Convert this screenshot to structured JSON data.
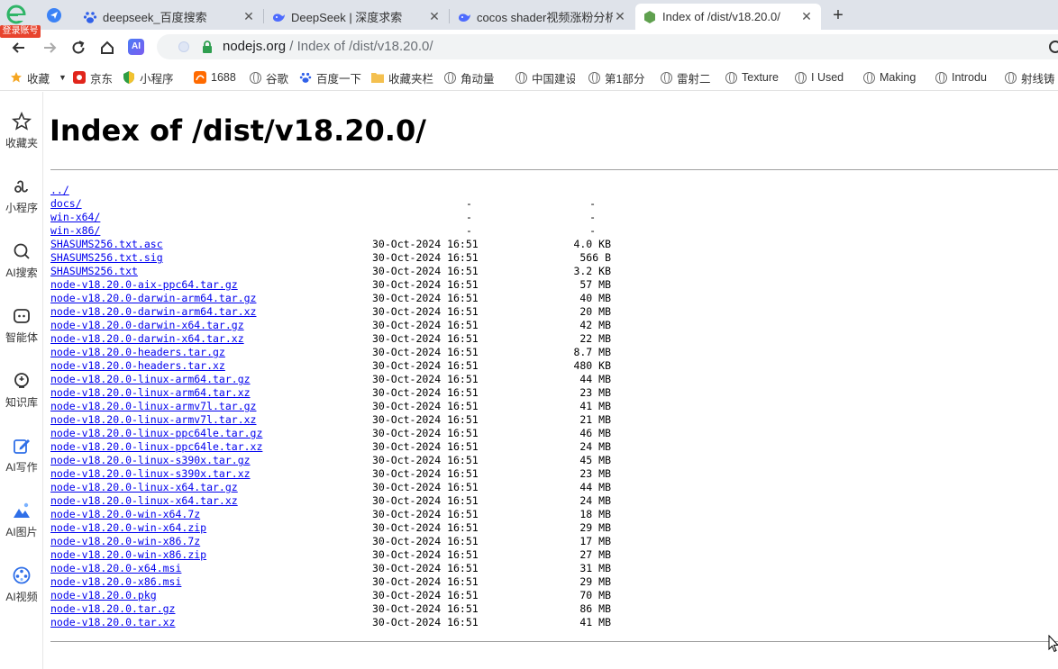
{
  "browser": {
    "login_badge": "登录账号",
    "tabs": [
      {
        "title": "deepseek_百度搜索",
        "icon": "baidu-paw-icon"
      },
      {
        "title": "DeepSeek | 深度求索",
        "icon": "deepseek-whale-icon"
      },
      {
        "title": "cocos shader视频涨粉分析",
        "icon": "deepseek-whale-icon"
      },
      {
        "title": "Index of /dist/v18.20.0/",
        "icon": "nodejs-hex-icon",
        "active": true
      }
    ],
    "address": {
      "host": "nodejs.org",
      "path": " / Index of /dist/v18.20.0/",
      "ai_label": "AI"
    }
  },
  "bookmarks": [
    {
      "label": "收藏",
      "icon": "star-icon"
    },
    {
      "label": "京东",
      "icon": "jd-icon"
    },
    {
      "label": "小程序",
      "icon": "shield-icon"
    },
    {
      "label": "1688",
      "icon": "1688-icon"
    },
    {
      "label": "谷歌",
      "icon": "globe-icon"
    },
    {
      "label": "百度一下",
      "icon": "baidu-paw-icon"
    },
    {
      "label": "收藏夹栏",
      "icon": "folder-icon"
    },
    {
      "label": "角动量",
      "icon": "globe-icon"
    },
    {
      "label": "中国建设",
      "icon": "globe-icon"
    },
    {
      "label": "第1部分",
      "icon": "globe-icon"
    },
    {
      "label": "雷射二",
      "icon": "globe-icon"
    },
    {
      "label": "Texture",
      "icon": "globe-icon"
    },
    {
      "label": "I Used",
      "icon": "globe-icon"
    },
    {
      "label": "Making",
      "icon": "globe-icon"
    },
    {
      "label": "Introdu",
      "icon": "globe-icon"
    },
    {
      "label": "射线铸",
      "icon": "globe-icon"
    }
  ],
  "sidebar": [
    {
      "label": "收藏夹",
      "icon": "star-icon"
    },
    {
      "label": "小程序",
      "icon": "mini-program-icon"
    },
    {
      "label": "AI搜索",
      "icon": "search-icon"
    },
    {
      "label": "智能体",
      "icon": "agent-icon"
    },
    {
      "label": "知识库",
      "icon": "knowledge-icon"
    },
    {
      "label": "AI写作",
      "icon": "pen-icon"
    },
    {
      "label": "AI图片",
      "icon": "image-icon"
    },
    {
      "label": "AI视频",
      "icon": "video-icon"
    }
  ],
  "page": {
    "title": "Index of /dist/v18.20.0/",
    "entries": [
      {
        "name": "../",
        "date": "",
        "size": ""
      },
      {
        "name": "docs/",
        "date": "-",
        "size": "-"
      },
      {
        "name": "win-x64/",
        "date": "-",
        "size": "-"
      },
      {
        "name": "win-x86/",
        "date": "-",
        "size": "-"
      },
      {
        "name": "SHASUMS256.txt.asc",
        "date": "30-Oct-2024 16:51",
        "size": "4.0 KB"
      },
      {
        "name": "SHASUMS256.txt.sig",
        "date": "30-Oct-2024 16:51",
        "size": "566 B"
      },
      {
        "name": "SHASUMS256.txt",
        "date": "30-Oct-2024 16:51",
        "size": "3.2 KB"
      },
      {
        "name": "node-v18.20.0-aix-ppc64.tar.gz",
        "date": "30-Oct-2024 16:51",
        "size": "57 MB"
      },
      {
        "name": "node-v18.20.0-darwin-arm64.tar.gz",
        "date": "30-Oct-2024 16:51",
        "size": "40 MB"
      },
      {
        "name": "node-v18.20.0-darwin-arm64.tar.xz",
        "date": "30-Oct-2024 16:51",
        "size": "20 MB"
      },
      {
        "name": "node-v18.20.0-darwin-x64.tar.gz",
        "date": "30-Oct-2024 16:51",
        "size": "42 MB"
      },
      {
        "name": "node-v18.20.0-darwin-x64.tar.xz",
        "date": "30-Oct-2024 16:51",
        "size": "22 MB"
      },
      {
        "name": "node-v18.20.0-headers.tar.gz",
        "date": "30-Oct-2024 16:51",
        "size": "8.7 MB"
      },
      {
        "name": "node-v18.20.0-headers.tar.xz",
        "date": "30-Oct-2024 16:51",
        "size": "480 KB"
      },
      {
        "name": "node-v18.20.0-linux-arm64.tar.gz",
        "date": "30-Oct-2024 16:51",
        "size": "44 MB"
      },
      {
        "name": "node-v18.20.0-linux-arm64.tar.xz",
        "date": "30-Oct-2024 16:51",
        "size": "23 MB"
      },
      {
        "name": "node-v18.20.0-linux-armv7l.tar.gz",
        "date": "30-Oct-2024 16:51",
        "size": "41 MB"
      },
      {
        "name": "node-v18.20.0-linux-armv7l.tar.xz",
        "date": "30-Oct-2024 16:51",
        "size": "21 MB"
      },
      {
        "name": "node-v18.20.0-linux-ppc64le.tar.gz",
        "date": "30-Oct-2024 16:51",
        "size": "46 MB"
      },
      {
        "name": "node-v18.20.0-linux-ppc64le.tar.xz",
        "date": "30-Oct-2024 16:51",
        "size": "24 MB"
      },
      {
        "name": "node-v18.20.0-linux-s390x.tar.gz",
        "date": "30-Oct-2024 16:51",
        "size": "45 MB"
      },
      {
        "name": "node-v18.20.0-linux-s390x.tar.xz",
        "date": "30-Oct-2024 16:51",
        "size": "23 MB"
      },
      {
        "name": "node-v18.20.0-linux-x64.tar.gz",
        "date": "30-Oct-2024 16:51",
        "size": "44 MB"
      },
      {
        "name": "node-v18.20.0-linux-x64.tar.xz",
        "date": "30-Oct-2024 16:51",
        "size": "24 MB"
      },
      {
        "name": "node-v18.20.0-win-x64.7z",
        "date": "30-Oct-2024 16:51",
        "size": "18 MB"
      },
      {
        "name": "node-v18.20.0-win-x64.zip",
        "date": "30-Oct-2024 16:51",
        "size": "29 MB"
      },
      {
        "name": "node-v18.20.0-win-x86.7z",
        "date": "30-Oct-2024 16:51",
        "size": "17 MB"
      },
      {
        "name": "node-v18.20.0-win-x86.zip",
        "date": "30-Oct-2024 16:51",
        "size": "27 MB"
      },
      {
        "name": "node-v18.20.0-x64.msi",
        "date": "30-Oct-2024 16:51",
        "size": "31 MB"
      },
      {
        "name": "node-v18.20.0-x86.msi",
        "date": "30-Oct-2024 16:51",
        "size": "29 MB"
      },
      {
        "name": "node-v18.20.0.pkg",
        "date": "30-Oct-2024 16:51",
        "size": "70 MB"
      },
      {
        "name": "node-v18.20.0.tar.gz",
        "date": "30-Oct-2024 16:51",
        "size": "86 MB"
      },
      {
        "name": "node-v18.20.0.tar.xz",
        "date": "30-Oct-2024 16:51",
        "size": "41 MB"
      }
    ]
  },
  "colors": {
    "link": "#0000ee",
    "tabstrip": "#dfe3ea",
    "badge": "#e8442e",
    "node_green": "#5fa04e"
  }
}
